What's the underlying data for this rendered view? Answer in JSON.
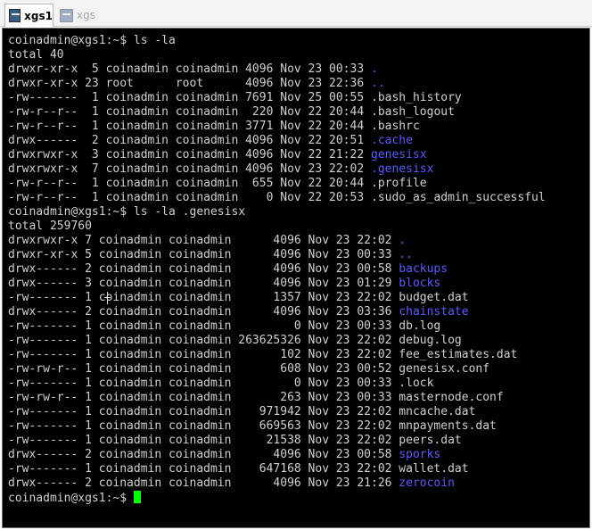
{
  "tabs": [
    {
      "label": "xgs1",
      "icon": "terminal-app-icon",
      "active": true
    },
    {
      "label": "xgs",
      "icon": "terminal-app-icon",
      "active": false
    }
  ],
  "colors": {
    "background": "#000000",
    "text": "#d0d0d0",
    "directory": "#5959ff",
    "cursor": "#00ff00"
  },
  "terminal": {
    "lines": [
      {
        "text": "coinadmin@xgs1:~$ ls -la"
      },
      {
        "text": "total 40"
      },
      {
        "text": "drwxr-xr-x  5 coinadmin coinadmin 4096 Nov 23 00:33 ",
        "name": ".",
        "dir": true
      },
      {
        "text": "drwxr-xr-x 23 root      root      4096 Nov 23 22:36 ",
        "name": "..",
        "dir": true
      },
      {
        "text": "-rw-------  1 coinadmin coinadmin 7691 Nov 25 00:55 ",
        "name": ".bash_history",
        "dir": false
      },
      {
        "text": "-rw-r--r--  1 coinadmin coinadmin  220 Nov 22 20:44 ",
        "name": ".bash_logout",
        "dir": false
      },
      {
        "text": "-rw-r--r--  1 coinadmin coinadmin 3771 Nov 22 20:44 ",
        "name": ".bashrc",
        "dir": false
      },
      {
        "text": "drwx------  2 coinadmin coinadmin 4096 Nov 22 20:51 ",
        "name": ".cache",
        "dir": true
      },
      {
        "text": "drwxrwxr-x  3 coinadmin coinadmin 4096 Nov 22 21:22 ",
        "name": "genesisx",
        "dir": true
      },
      {
        "text": "drwxrwxr-x  7 coinadmin coinadmin 4096 Nov 23 22:02 ",
        "name": ".genesisx",
        "dir": true
      },
      {
        "text": "-rw-r--r--  1 coinadmin coinadmin  655 Nov 22 20:44 ",
        "name": ".profile",
        "dir": false
      },
      {
        "text": "-rw-r--r--  1 coinadmin coinadmin    0 Nov 22 20:53 ",
        "name": ".sudo_as_admin_successful",
        "dir": false
      },
      {
        "text": "coinadmin@xgs1:~$ ls -la .genesisx"
      },
      {
        "text": "total 259760"
      },
      {
        "text": "drwxrwxr-x 7 coinadmin coinadmin      4096 Nov 23 22:02 ",
        "name": ".",
        "dir": true
      },
      {
        "text": "drwxr-xr-x 5 coinadmin coinadmin      4096 Nov 23 00:33 ",
        "name": "..",
        "dir": true
      },
      {
        "text": "drwx------ 2 coinadmin coinadmin      4096 Nov 23 00:58 ",
        "name": "backups",
        "dir": true
      },
      {
        "text": "drwx------ 3 coinadmin coinadmin      4096 Nov 23 01:29 ",
        "name": "blocks",
        "dir": true
      },
      {
        "text": "-rw------- 1 coinadmin coinadmin      1357 Nov 23 22:02 ",
        "name": "budget.dat",
        "dir": false
      },
      {
        "text": "drwx------ 2 coinadmin coinadmin      4096 Nov 23 03:36 ",
        "name": "chainstate",
        "dir": true
      },
      {
        "text": "-rw------- 1 coinadmin coinadmin         0 Nov 23 00:33 ",
        "name": "db.log",
        "dir": false
      },
      {
        "text": "-rw------- 1 coinadmin coinadmin 263625326 Nov 23 22:02 ",
        "name": "debug.log",
        "dir": false
      },
      {
        "text": "-rw------- 1 coinadmin coinadmin       102 Nov 23 22:02 ",
        "name": "fee_estimates.dat",
        "dir": false
      },
      {
        "text": "-rw-rw-r-- 1 coinadmin coinadmin       608 Nov 23 00:52 ",
        "name": "genesisx.conf",
        "dir": false
      },
      {
        "text": "-rw------- 1 coinadmin coinadmin         0 Nov 23 00:33 ",
        "name": ".lock",
        "dir": false
      },
      {
        "text": "-rw-rw-r-- 1 coinadmin coinadmin       263 Nov 23 00:33 ",
        "name": "masternode.conf",
        "dir": false
      },
      {
        "text": "-rw------- 1 coinadmin coinadmin    971942 Nov 23 22:02 ",
        "name": "mncache.dat",
        "dir": false
      },
      {
        "text": "-rw------- 1 coinadmin coinadmin    669563 Nov 23 22:02 ",
        "name": "mnpayments.dat",
        "dir": false
      },
      {
        "text": "-rw------- 1 coinadmin coinadmin     21538 Nov 23 22:02 ",
        "name": "peers.dat",
        "dir": false
      },
      {
        "text": "drwx------ 2 coinadmin coinadmin      4096 Nov 23 00:58 ",
        "name": "sporks",
        "dir": true
      },
      {
        "text": "-rw------- 1 coinadmin coinadmin    647168 Nov 23 22:02 ",
        "name": "wallet.dat",
        "dir": false
      },
      {
        "text": "drwx------ 2 coinadmin coinadmin      4096 Nov 23 21:26 ",
        "name": "zerocoin",
        "dir": true
      }
    ],
    "prompt": "coinadmin@xgs1:~$ "
  }
}
